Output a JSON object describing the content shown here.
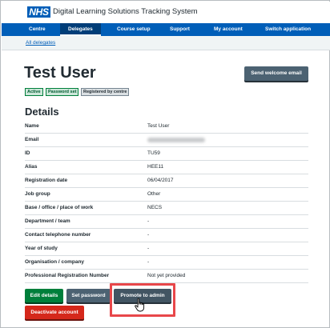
{
  "header": {
    "logo_text": "NHS",
    "app_title": "Digital Learning Solutions Tracking System"
  },
  "nav": {
    "items": [
      {
        "label": "Centre"
      },
      {
        "label": "Delegates"
      },
      {
        "label": "Course setup"
      },
      {
        "label": "Support"
      },
      {
        "label": "My account"
      },
      {
        "label": "Switch application"
      }
    ],
    "active": "Delegates"
  },
  "breadcrumb": {
    "label": "All delegates"
  },
  "page": {
    "title": "Test User",
    "send_welcome_email_label": "Send welcome email",
    "tags": [
      "Active",
      "Password set",
      "Registered by centre"
    ]
  },
  "details": {
    "heading": "Details",
    "rows": [
      {
        "label": "Name",
        "value": "Test User"
      },
      {
        "label": "Email",
        "value": ""
      },
      {
        "label": "ID",
        "value": "TU59"
      },
      {
        "label": "Alias",
        "value": "HEE11"
      },
      {
        "label": "Registration date",
        "value": "06/04/2017"
      },
      {
        "label": "Job group",
        "value": "Other"
      },
      {
        "label": "Base / office / place of work",
        "value": "NECS"
      },
      {
        "label": "Department / team",
        "value": "-"
      },
      {
        "label": "Contact telephone number",
        "value": "-"
      },
      {
        "label": "Year of study",
        "value": "-"
      },
      {
        "label": "Organisation / company",
        "value": "-"
      },
      {
        "label": "Professional Registration Number",
        "value": "Not yet provided"
      }
    ]
  },
  "actions": {
    "edit_details": "Edit details",
    "set_password": "Set password",
    "promote_to_admin": "Promote to admin",
    "deactivate_account": "Deactivate account"
  },
  "colors": {
    "nhs_blue": "#005eb8",
    "green": "#007f3b",
    "red": "#d5281b",
    "slate": "#4c6272",
    "highlight": "#e8474a"
  }
}
